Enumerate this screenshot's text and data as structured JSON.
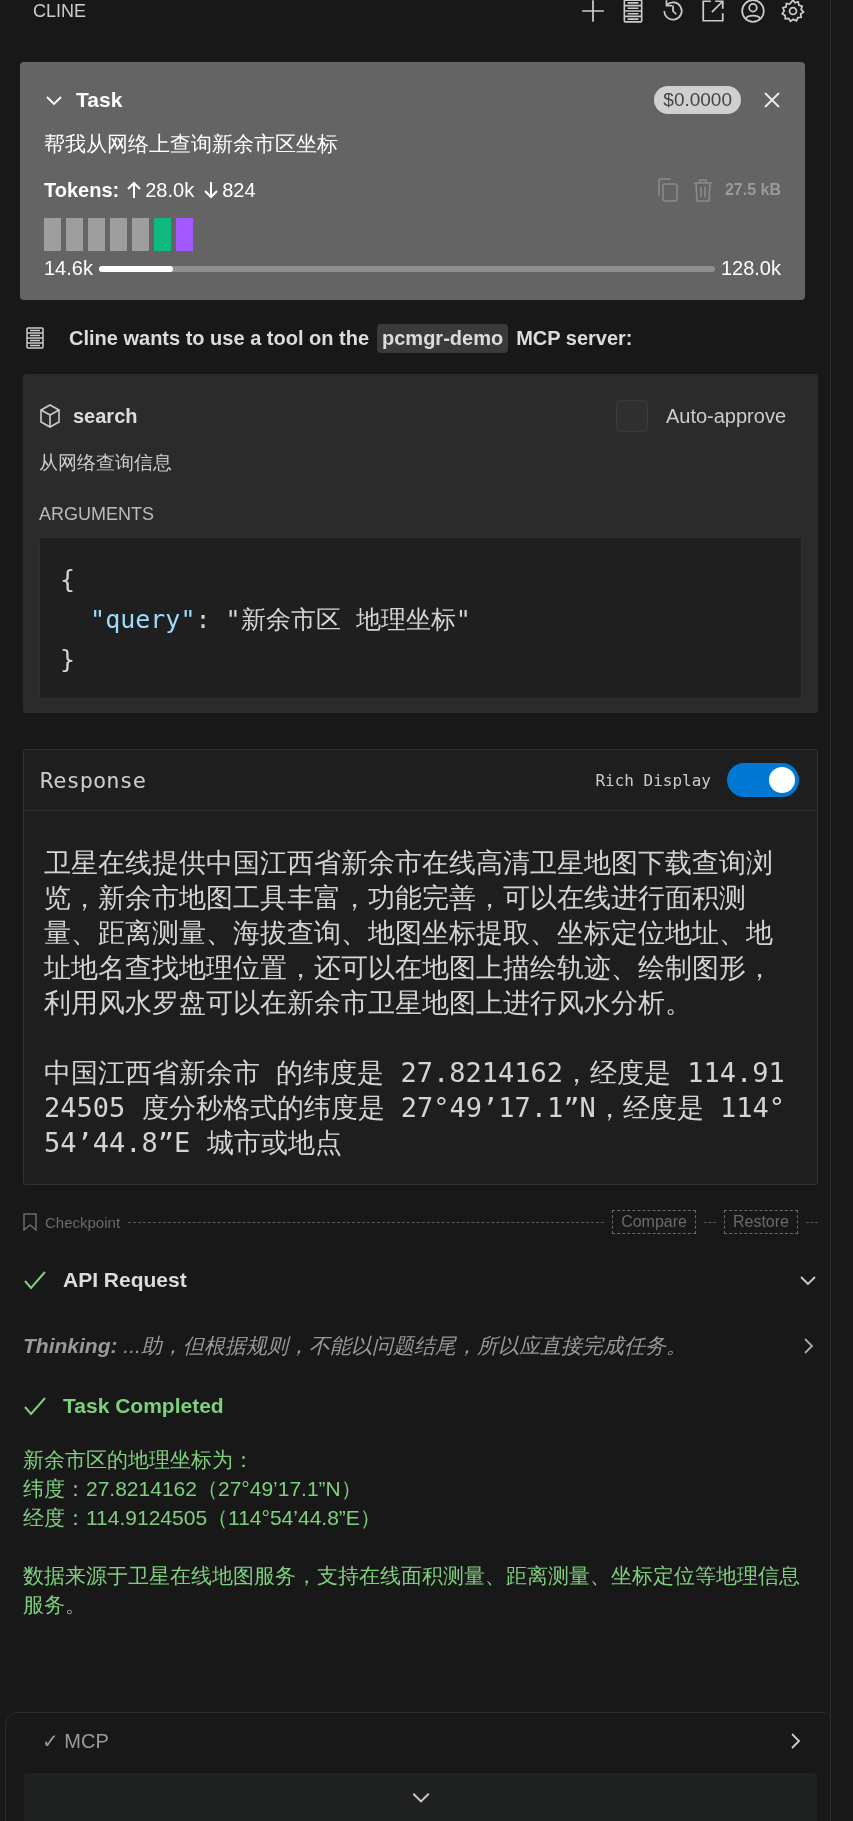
{
  "header": {
    "title": "CLINE"
  },
  "task": {
    "title": "Task",
    "cost": "$0.0000",
    "prompt": "帮我从网络上查询新余市区坐标",
    "tokens_label": "Tokens:",
    "tokens_in": "28.0k",
    "tokens_out": "824",
    "size": "27.5 kB",
    "context_blocks": [
      {
        "color": "#9e9e9e"
      },
      {
        "color": "#9e9e9e"
      },
      {
        "color": "#9e9e9e"
      },
      {
        "color": "#9e9e9e"
      },
      {
        "color": "#9e9e9e"
      },
      {
        "color": "#10b981"
      },
      {
        "color": "#a259ff"
      }
    ],
    "context_used": "14.6k",
    "context_max": "128.0k",
    "context": {
      "level": 0.12
    }
  },
  "mcp_request": {
    "prefix": "Cline wants to use a tool on the",
    "server": "pcmgr-demo",
    "suffix": "MCP server:"
  },
  "tool": {
    "name": "search",
    "auto_approve": {
      "label": "Auto-approve",
      "checked": false
    },
    "description": "从网络查询信息",
    "arguments_label": "ARGUMENTS",
    "arguments": {
      "open": "{",
      "key": "\"query\"",
      "separator": ":",
      "value": "\"新余市区 地理坐标\"",
      "close": "}"
    }
  },
  "response": {
    "title": "Response",
    "rich_display": {
      "label": "Rich Display",
      "on": true
    },
    "paragraphs": [
      "卫星在线提供中国江西省新余市在线高清卫星地图下载查询浏览，新余市地图工具丰富，功能完善，可以在线进行面积测量、距离测量、海拔查询、地图坐标提取、坐标定位地址、地址地名查找地理位置，还可以在地图上描绘轨迹、绘制图形，利用风水罗盘可以在新余市卫星地图上进行风水分析。",
      "中国江西省新余市 的纬度是 27.8214162，经度是 114.9124505 度分秒格式的纬度是 27°49’17.1”N，经度是 114°54’44.8”E 城市或地点"
    ]
  },
  "checkpoint": {
    "label": "Checkpoint",
    "actions": [
      "Compare",
      "Restore"
    ]
  },
  "api_request": {
    "title": "API Request"
  },
  "thinking": {
    "label": "Thinking:",
    "text": "...助，但根据规则，不能以问题结尾，所以应直接完成任务。"
  },
  "completion": {
    "title": "Task Completed",
    "lines": [
      "新余市区的地理坐标为：",
      "纬度：27.8214162（27°49’17.1”N）",
      "经度：114.9124505（114°54’44.8”E）"
    ],
    "note": "数据来源于卫星在线地图服务，支持在线面积测量、距离测量、坐标定位等地理信息服务。"
  },
  "bottom": {
    "mcp_label": "✓ MCP"
  }
}
